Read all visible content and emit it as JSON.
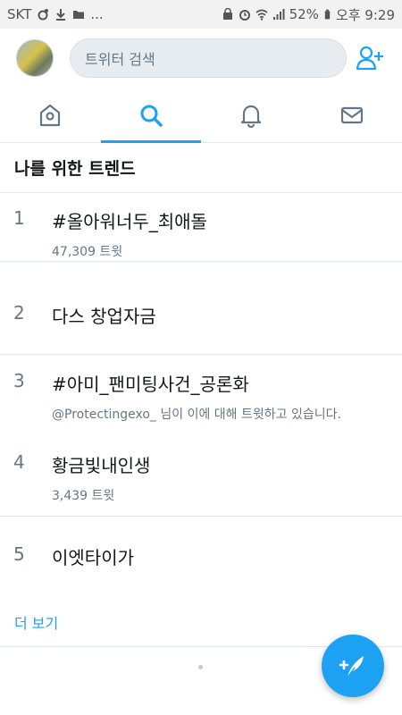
{
  "status_bar": {
    "carrier": "SKT",
    "overflow": "...",
    "battery": "52%",
    "time": "오후 9:29"
  },
  "header": {
    "search_placeholder": "트위터 검색"
  },
  "tabs": [
    {
      "icon": "home-icon",
      "active": false
    },
    {
      "icon": "search-icon",
      "active": true
    },
    {
      "icon": "bell-icon",
      "active": false
    },
    {
      "icon": "mail-icon",
      "active": false
    }
  ],
  "section": {
    "title": "나를 위한 트렌드"
  },
  "trends": [
    {
      "rank": "1",
      "name": "#올아워너두_최애돌",
      "meta": "47,309 트윗"
    },
    {
      "rank": "2",
      "name": "다스 창업자금",
      "meta": ""
    },
    {
      "rank": "3",
      "name": "#아미_팬미팅사건_공론화",
      "meta": "@Protectingexo_ 님이 이에 대해 트윗하고 있습니다."
    },
    {
      "rank": "4",
      "name": "황금빛내인생",
      "meta": "3,439 트윗"
    },
    {
      "rank": "5",
      "name": "이엣타이가",
      "meta": ""
    }
  ],
  "more_label": "더 보기",
  "colors": {
    "accent": "#1da1f2",
    "text": "#14171a",
    "muted": "#657786"
  }
}
